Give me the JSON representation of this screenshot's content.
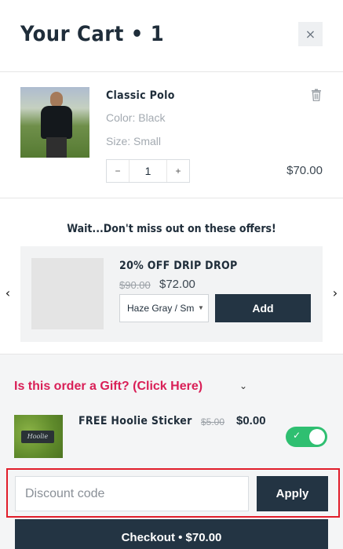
{
  "header": {
    "title": "Your Cart • 1",
    "close_label": "×"
  },
  "line_item": {
    "name": "Classic Polo",
    "color": "Color: Black",
    "size": "Size: Small",
    "quantity": "1",
    "qty_minus": "−",
    "qty_plus": "+",
    "price": "$70.00",
    "image_icon": "product-photo"
  },
  "offers": {
    "heading": "Wait...Don't miss out on these offers!",
    "items": [
      {
        "name": "20% OFF DRIP DROP",
        "compare_price": "$90.00",
        "price": "$72.00",
        "variant_selected": "Haze Gray / Sm",
        "add_label": "Add"
      }
    ],
    "prev_arrow": "‹",
    "next_arrow": "›"
  },
  "gift": {
    "link_text": "Is this order a Gift? (Click Here)",
    "chevron": "⌄"
  },
  "sticker": {
    "name": "FREE Hoolie Sticker",
    "compare_price": "$5.00",
    "price": "$0.00",
    "toggle_on": true,
    "toggle_check": "✓",
    "tag_text": "Hoolie"
  },
  "discount": {
    "placeholder": "Discount code",
    "apply_label": "Apply"
  },
  "checkout": {
    "label": "Checkout • $70.00"
  },
  "colors": {
    "primary": "#233443",
    "accent_pink": "#d91f57",
    "toggle_green": "#2fbf71",
    "highlight_red": "#e11d2a"
  }
}
